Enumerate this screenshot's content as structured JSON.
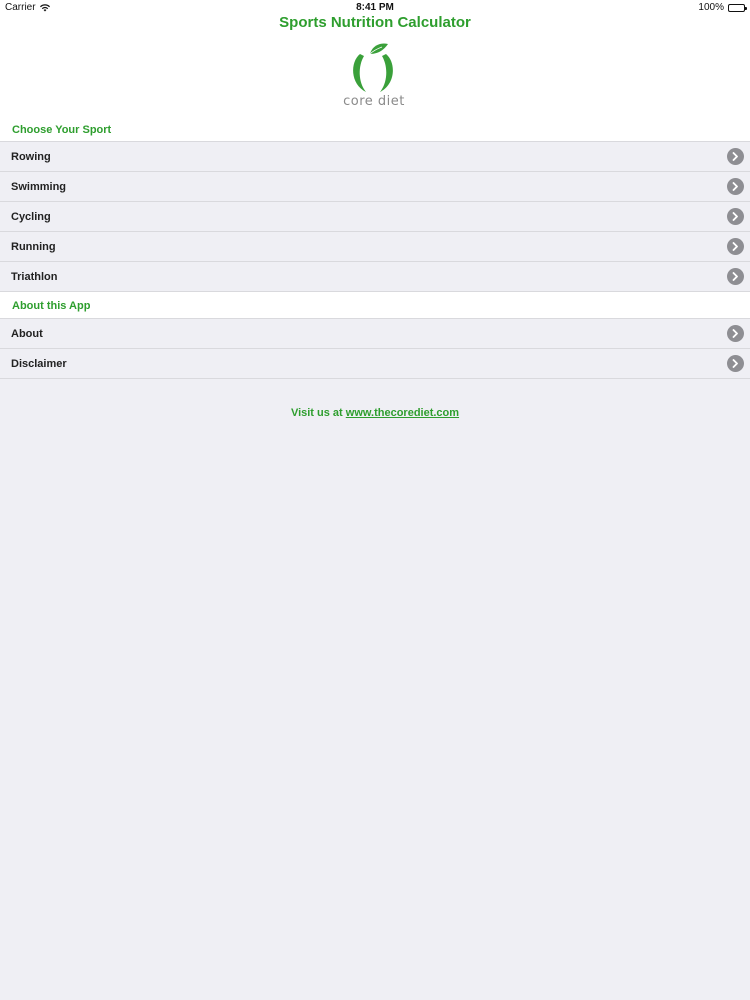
{
  "status_bar": {
    "carrier": "Carrier",
    "time": "8:41 PM",
    "battery": "100%",
    "wifi_icon": "wifi-icon",
    "battery_icon": "battery-icon"
  },
  "header": {
    "title": "Sports Nutrition Calculator",
    "logo_text": "core diet"
  },
  "sports": {
    "header": "Choose Your Sport",
    "items": [
      {
        "label": "Rowing"
      },
      {
        "label": "Swimming"
      },
      {
        "label": "Cycling"
      },
      {
        "label": "Running"
      },
      {
        "label": "Triathlon"
      }
    ]
  },
  "about": {
    "header": "About this App",
    "items": [
      {
        "label": "About"
      },
      {
        "label": "Disclaimer"
      }
    ]
  },
  "footer": {
    "prefix": "Visit us at",
    "link": "www.thecorediet.com"
  },
  "colors": {
    "accent": "#2e9e2e",
    "background": "#efeff4",
    "disclosure": "#8e8e93"
  }
}
